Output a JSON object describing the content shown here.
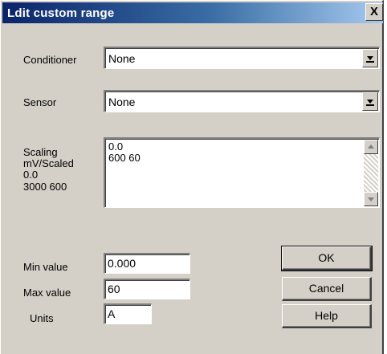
{
  "window": {
    "title": "Ldit custom range",
    "close_glyph": "X"
  },
  "conditioner": {
    "label": "Conditioner",
    "value": "None"
  },
  "sensor": {
    "label": "Sensor",
    "value": "None"
  },
  "scaling": {
    "label_lines": [
      "Scaling",
      "mV/Scaled",
      "0.0",
      "3000 600"
    ],
    "lines": [
      "0.0",
      "600 60"
    ]
  },
  "min_value": {
    "label": "Min value",
    "value": "0.000"
  },
  "max_value": {
    "label": "Max value",
    "value": "60"
  },
  "units": {
    "label": "Units",
    "value": "A"
  },
  "buttons": {
    "ok": "OK",
    "cancel": "Cancel",
    "help": "Help"
  },
  "icons": {
    "dropdown": "chevron-down-icon",
    "scroll_up": "arrow-up-icon",
    "scroll_down": "arrow-down-icon",
    "close": "close-icon"
  },
  "colors": {
    "titlebar_start": "#0a246a",
    "titlebar_end": "#a6caf0",
    "dialog_face": "#d4d0c8"
  }
}
